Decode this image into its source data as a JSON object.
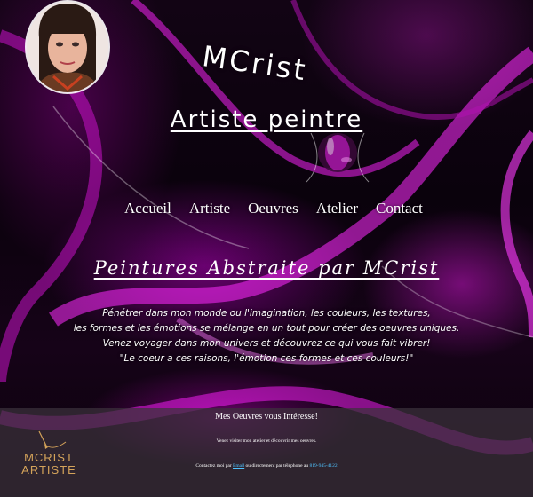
{
  "site": {
    "title": "MCrist",
    "subtitle": "Artiste peintre"
  },
  "nav": {
    "items": [
      "Accueil",
      "Artiste",
      "Oeuvres",
      "Atelier",
      "Contact"
    ]
  },
  "main": {
    "headline": "Peintures Abstraite par MCrist",
    "intro_lines": [
      "Pénétrer dans mon monde ou l'imagination, les couleurs, les textures,",
      "les formes et les émotions se mélange en un tout pour créer des oeuvres uniques.",
      "Venez voyager dans mon univers et découvrez ce qui vous fait vibrer!",
      "\"Le coeur a ces raisons, l'émotion ces formes et ces couleurs!\""
    ]
  },
  "footer": {
    "title": "Mes Oeuvres vous Intéresse!",
    "text": "Venez visiter mon atelier et découvrir mes oeuvres.",
    "contact_prefix": "Contactez moi par",
    "contact_link": "Email",
    "contact_middle": "ou directement par téléphone au",
    "phone": "819-945-4122",
    "logo_line1": "MCRIST",
    "logo_line2": "ARTISTE"
  },
  "colors": {
    "accent_magenta": "#e020e0",
    "footer_logo": "#d4a35a",
    "link": "#4fc3ff"
  }
}
